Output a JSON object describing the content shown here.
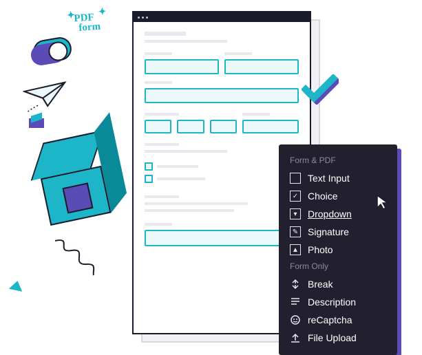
{
  "badge": {
    "line1": "PDF",
    "line2": "form"
  },
  "menu": {
    "section1_title": "Form & PDF",
    "section2_title": "Form Only",
    "items_pdf": [
      {
        "label": "Text Input",
        "icon": "text-input-icon"
      },
      {
        "label": "Choice",
        "icon": "choice-icon"
      },
      {
        "label": "Dropdown",
        "icon": "dropdown-icon",
        "hover": true
      },
      {
        "label": "Signature",
        "icon": "signature-icon"
      },
      {
        "label": "Photo",
        "icon": "photo-icon"
      }
    ],
    "items_form": [
      {
        "label": "Break",
        "icon": "break-icon"
      },
      {
        "label": "Description",
        "icon": "description-icon"
      },
      {
        "label": "reCaptcha",
        "icon": "recaptcha-icon"
      },
      {
        "label": "File Upload",
        "icon": "file-upload-icon"
      }
    ]
  },
  "colors": {
    "accent": "#1db6c9",
    "dark": "#22202f",
    "purple": "#5b4bb7"
  }
}
